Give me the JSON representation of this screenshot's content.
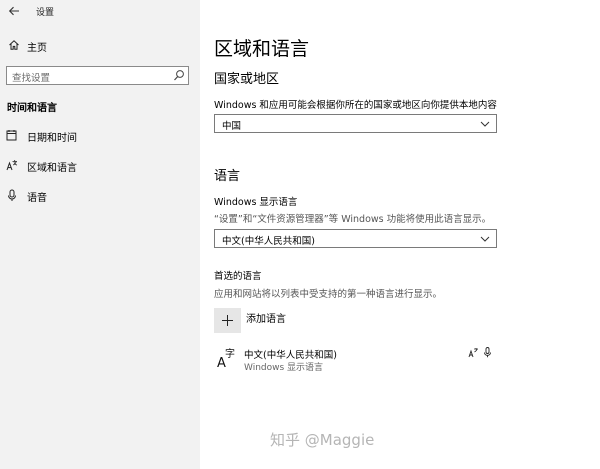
{
  "window": {
    "app_title": "设置"
  },
  "sidebar": {
    "home_label": "主页",
    "search_placeholder": "查找设置",
    "section_label": "时间和语言",
    "items": [
      {
        "label": "日期和时间",
        "icon": "calendar-clock-icon"
      },
      {
        "label": "区域和语言",
        "icon": "region-language-icon"
      },
      {
        "label": "语音",
        "icon": "microphone-icon"
      }
    ]
  },
  "main": {
    "page_title": "区域和语言",
    "country": {
      "heading": "国家或地区",
      "description": "Windows 和应用可能会根据你所在的国家或地区向你提供本地内容",
      "selected": "中国"
    },
    "language": {
      "heading": "语言",
      "display_label": "Windows 显示语言",
      "display_desc": "“设置”和“文件资源管理器”等 Windows 功能将使用此语言显示。",
      "display_selected": "中文(中华人民共和国)",
      "preferred_label": "首选的语言",
      "preferred_desc": "应用和网站将以列表中受支持的第一种语言进行显示。",
      "add_label": "添加语言",
      "entries": [
        {
          "name": "中文(中华人民共和国)",
          "sub": "Windows 显示语言"
        }
      ]
    }
  },
  "watermark": "知乎 @Maggie"
}
